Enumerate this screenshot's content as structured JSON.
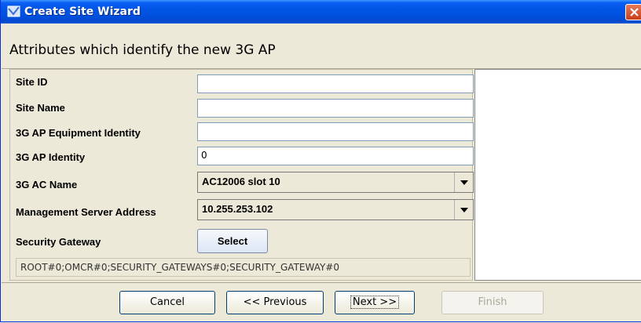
{
  "window": {
    "title": "Create Site Wizard"
  },
  "header": {
    "text": "Attributes which identify the new 3G AP"
  },
  "form": {
    "site_id": {
      "label": "Site ID",
      "value": ""
    },
    "site_name": {
      "label": "Site Name",
      "value": ""
    },
    "equipment_identity": {
      "label": "3G AP Equipment Identity",
      "value": ""
    },
    "ap_identity": {
      "label": "3G AP Identity",
      "value": "0"
    },
    "ac_name": {
      "label": "3G AC Name",
      "value": "AC12006 slot 10"
    },
    "mgmt_server": {
      "label": "Management Server Address",
      "value": "10.255.253.102"
    },
    "security_gateway": {
      "label": "Security Gateway",
      "button": "Select"
    },
    "path": "ROOT#0;OMCR#0;SECURITY_GATEWAYS#0;SECURITY_GATEWAY#0"
  },
  "buttons": {
    "cancel": "Cancel",
    "previous": "<< Previous",
    "next": "Next >>",
    "finish": "Finish"
  },
  "icons": {
    "title": "wizard-app-icon",
    "close": "close-icon",
    "dropdown": "chevron-down-icon"
  }
}
